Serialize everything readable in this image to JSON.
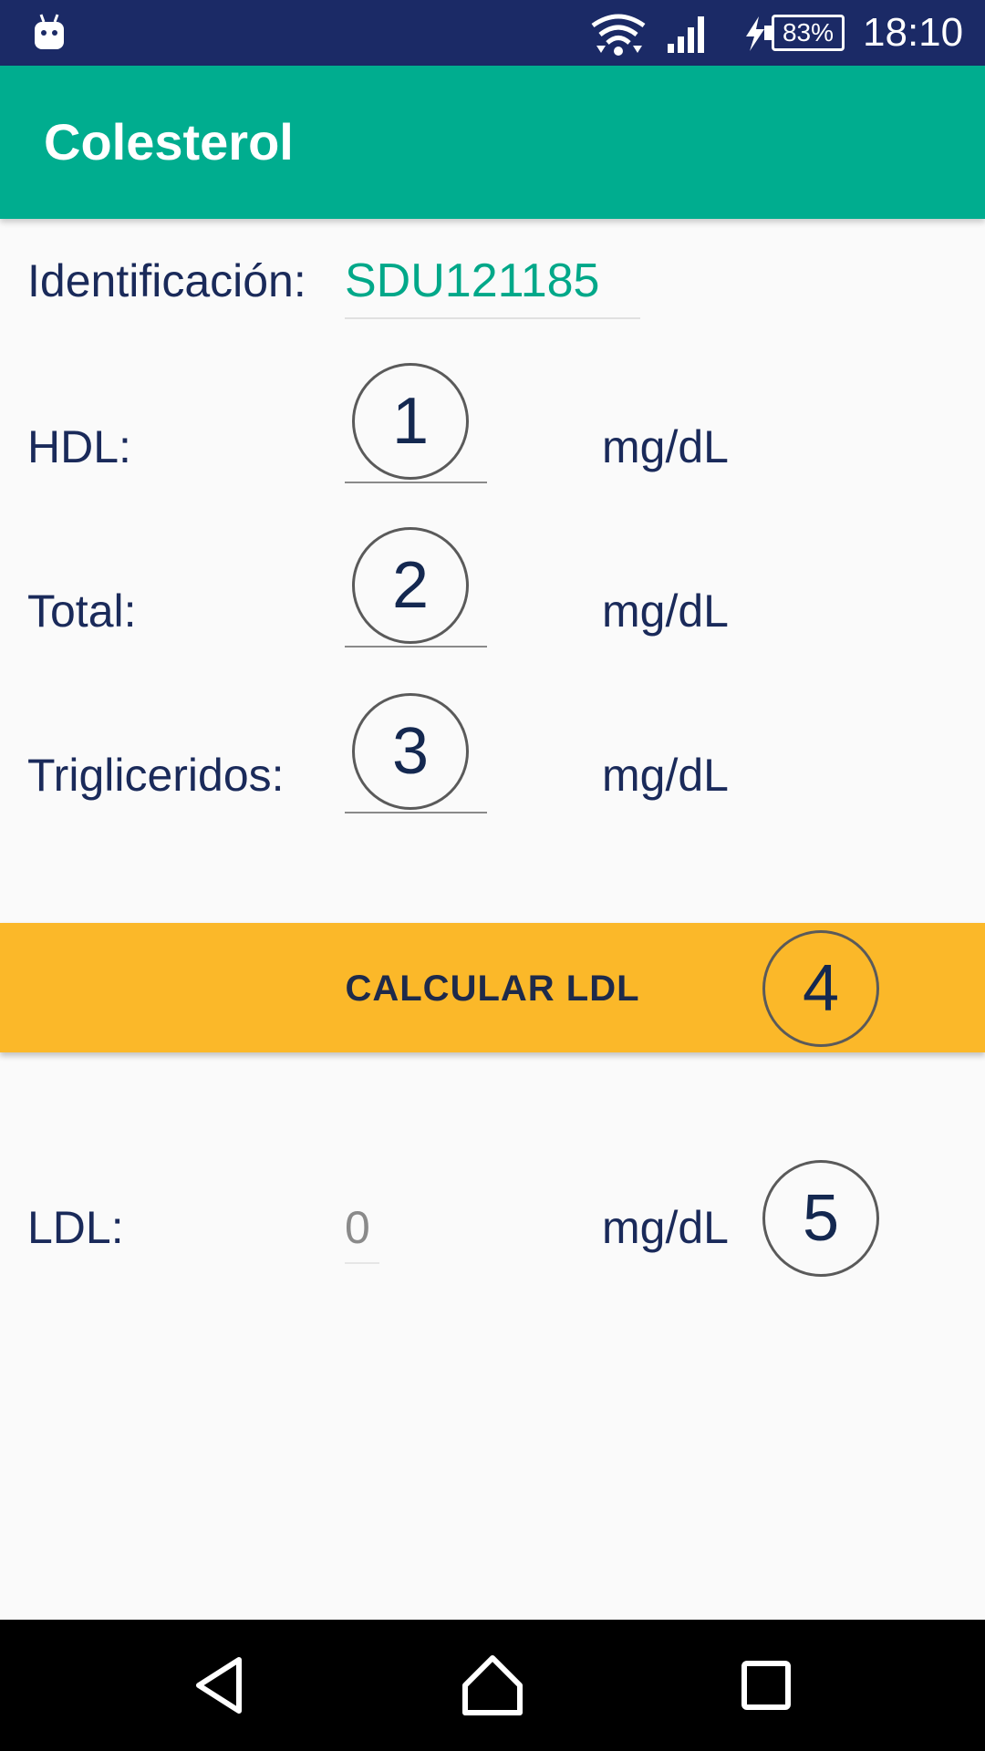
{
  "status_bar": {
    "battery_percent": "83%",
    "time": "18:10",
    "icons": [
      "android-icon",
      "wifi-icon",
      "signal-icon",
      "charge-icon",
      "battery-icon"
    ]
  },
  "app_bar": {
    "title": "Colesterol"
  },
  "form": {
    "identificacion_label": "Identificación:",
    "identificacion_value": "SDU121185",
    "hdl_label": "HDL:",
    "total_label": "Total:",
    "trigliceridos_label": "Trigliceridos:",
    "unit": "mg/dL"
  },
  "calc_button": {
    "label": "CALCULAR LDL"
  },
  "result": {
    "ldl_label": "LDL:",
    "ldl_value": "0",
    "unit": "mg/dL"
  },
  "annotations": {
    "badge_1": "1",
    "badge_2": "2",
    "badge_3": "3",
    "badge_4": "4",
    "badge_5": "5"
  },
  "colors": {
    "status_bar": "#1b2a66",
    "app_bar": "#00ad8f",
    "accent_text": "#00a889",
    "button": "#fbb829",
    "text": "#1a2a5a"
  },
  "nav_bar": {
    "icons": [
      "back-icon",
      "home-icon",
      "recents-icon"
    ]
  }
}
